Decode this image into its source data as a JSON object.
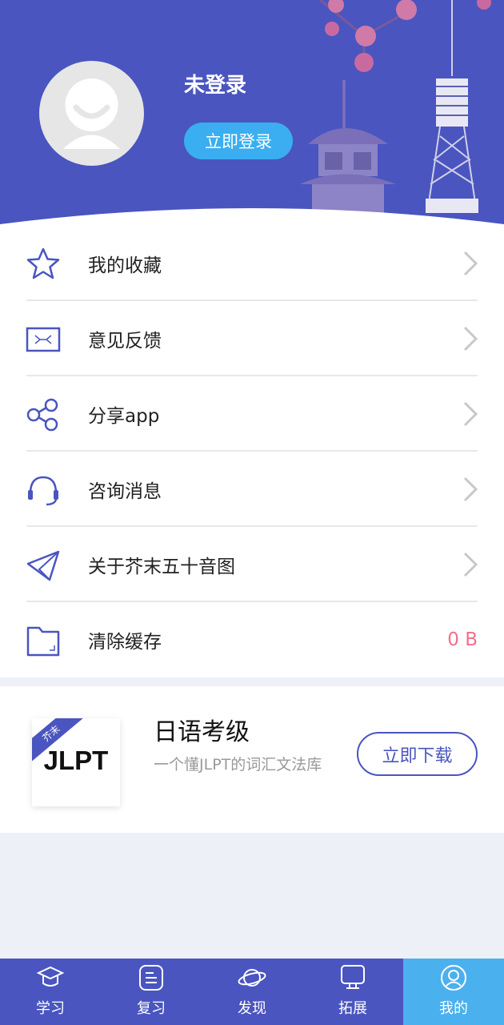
{
  "profile": {
    "username": "未登录",
    "login_button": "立即登录"
  },
  "menu": [
    {
      "label": "我的收藏",
      "icon": "star-icon"
    },
    {
      "label": "意见反馈",
      "icon": "envelope-icon"
    },
    {
      "label": "分享app",
      "icon": "share-icon"
    },
    {
      "label": "咨询消息",
      "icon": "headset-icon"
    },
    {
      "label": "关于芥末五十音图",
      "icon": "paper-plane-icon"
    },
    {
      "label": "清除缓存",
      "icon": "folder-icon",
      "value": "0 B"
    }
  ],
  "promo": {
    "logo_text": "JLPT",
    "logo_ribbon": "芥末",
    "title": "日语考级",
    "description": "一个懂JLPT的词汇文法库",
    "button": "立即下载"
  },
  "tabs": [
    {
      "label": "学习",
      "icon": "graduation-cap-icon"
    },
    {
      "label": "复习",
      "icon": "document-icon"
    },
    {
      "label": "发现",
      "icon": "planet-icon"
    },
    {
      "label": "拓展",
      "icon": "monitor-icon"
    },
    {
      "label": "我的",
      "icon": "user-icon",
      "active": true
    }
  ],
  "colors": {
    "primary": "#4a55c0",
    "accent": "#3aaef0",
    "cache_value": "#f0708a",
    "active_tab": "#4bb0ee"
  }
}
